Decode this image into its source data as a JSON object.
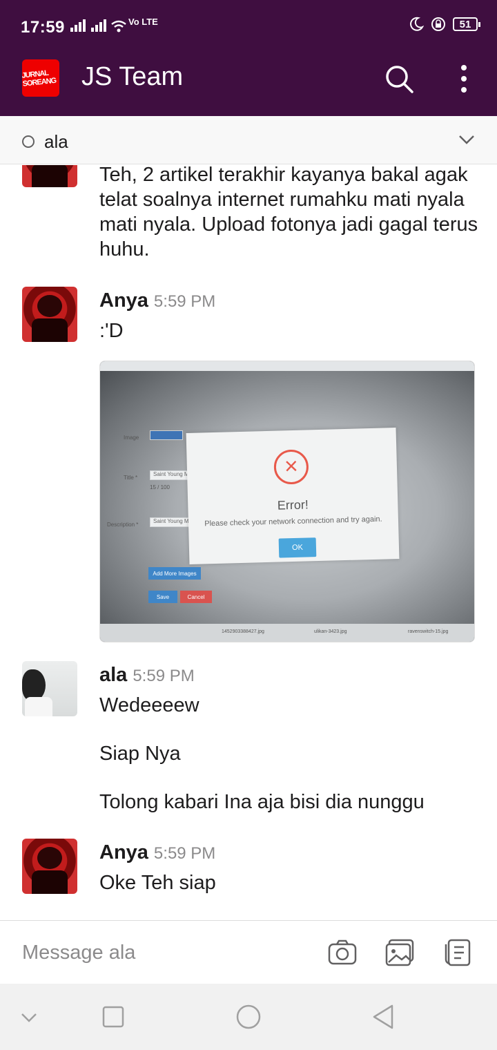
{
  "status_bar": {
    "time": "17:59",
    "network": "Vo LTE",
    "battery": "51"
  },
  "app_bar": {
    "title": "JS Team",
    "logo_text": "JURNAL SOREANG"
  },
  "channel": {
    "name": "ala"
  },
  "messages": [
    {
      "text": "Teh, 2 artikel terakhir kayanya bakal agak telat soalnya internet rumahku mati nyala mati nyala. Upload fotonya jadi gagal terus huhu."
    },
    {
      "sender": "Anya",
      "time": "5:59 PM",
      "text": ":'D",
      "attachment": {
        "dialog_title": "Error!",
        "dialog_message": "Please check your network connection and try again.",
        "ok_label": "OK",
        "form": {
          "image_label": "Image",
          "title_label": "Title *",
          "title_value": "Saint Young M",
          "counter": "15 / 100",
          "description_label": "Description *",
          "description_value": "Saint Young M",
          "add_more": "Add More Images",
          "save": "Save",
          "cancel": "Cancel"
        },
        "downloads": [
          "1452903388427.jpg",
          "ulikan-3423.jpg",
          "ravenswitch-15.jpg"
        ]
      }
    },
    {
      "sender": "ala",
      "time": "5:59 PM",
      "lines": [
        "Wedeeeew",
        "Siap Nya",
        "Tolong kabari Ina aja bisi dia nunggu"
      ]
    },
    {
      "sender": "Anya",
      "time": "5:59 PM",
      "text": "Oke Teh siap"
    }
  ],
  "composer": {
    "placeholder": "Message ala"
  },
  "icons": {
    "search": "search-icon",
    "more": "more-vert-icon",
    "camera": "camera-icon",
    "gallery": "gallery-icon",
    "files": "files-icon"
  }
}
